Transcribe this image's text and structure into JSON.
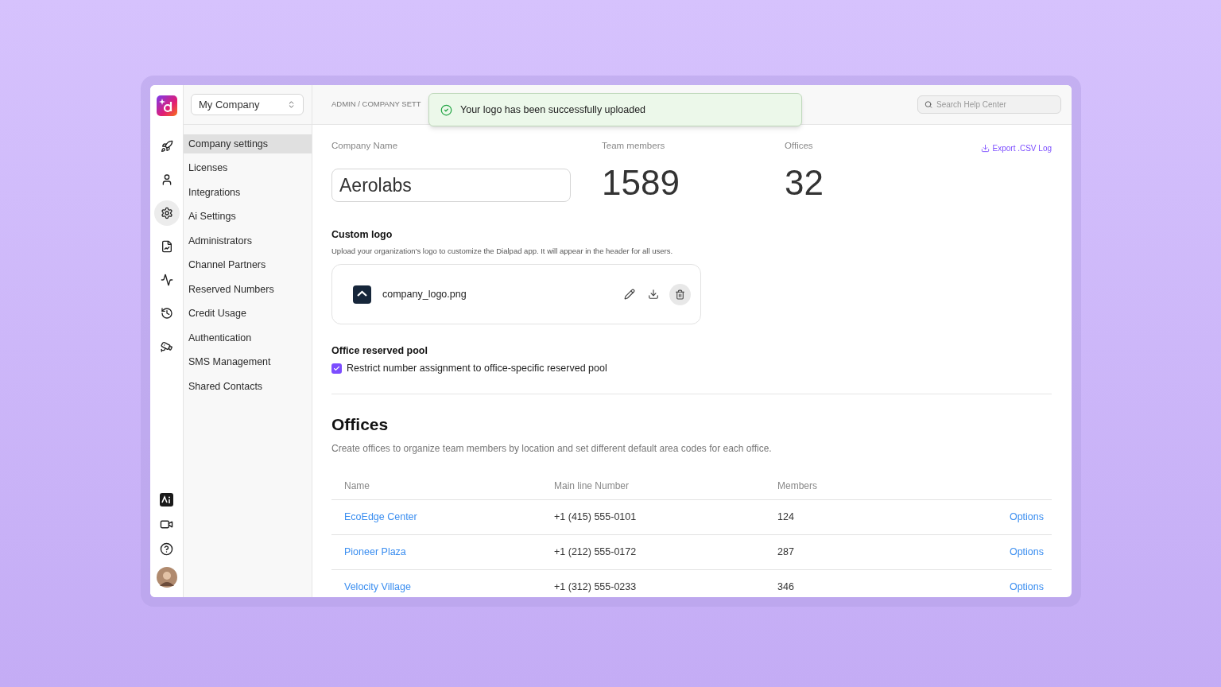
{
  "rail": {
    "top": [
      {
        "selected": false
      },
      {
        "selected": false
      },
      {
        "selected": true
      },
      {
        "selected": false
      },
      {
        "selected": false
      },
      {
        "selected": false
      },
      {
        "selected": false
      }
    ]
  },
  "company_switcher": {
    "value": "My Company"
  },
  "sidebar": {
    "items": [
      {
        "label": "Company settings",
        "selected": true
      },
      {
        "label": "Licenses",
        "selected": false
      },
      {
        "label": "Integrations",
        "selected": false
      },
      {
        "label": "Ai Settings",
        "selected": false
      },
      {
        "label": "Administrators",
        "selected": false
      },
      {
        "label": "Channel Partners",
        "selected": false
      },
      {
        "label": "Reserved Numbers",
        "selected": false
      },
      {
        "label": "Credit Usage",
        "selected": false
      },
      {
        "label": "Authentication",
        "selected": false
      },
      {
        "label": "SMS Management",
        "selected": false
      },
      {
        "label": "Shared Contacts",
        "selected": false
      }
    ]
  },
  "breadcrumb": "ADMIN / COMPANY SETT",
  "toast": {
    "message": "Your logo has been successfully uploaded"
  },
  "search": {
    "placeholder": "Search Help Center"
  },
  "stats": {
    "company_name_label": "Company Name",
    "company_name": "Aerolabs",
    "team_members_label": "Team members",
    "team_members": "1589",
    "offices_label": "Offices",
    "offices": "32",
    "export": "Export .CSV Log"
  },
  "custom_logo": {
    "title": "Custom logo",
    "description": "Upload your organization's logo to customize the Dialpad app. It will appear in the header for all users.",
    "file": "company_logo.png"
  },
  "reserved_pool": {
    "title": "Office reserved pool",
    "label": "Restrict number assignment to office-specific reserved pool",
    "checked": true
  },
  "offices": {
    "title": "Offices",
    "description": "Create offices to organize team members by location and set different default area codes for each office.",
    "columns": [
      "Name",
      "Main line Number",
      "Members"
    ],
    "rows": [
      {
        "name": "EcoEdge Center",
        "number": "+1 (415) 555-0101",
        "members": "124",
        "action": "Options"
      },
      {
        "name": "Pioneer Plaza",
        "number": "+1 (212) 555-0172",
        "members": "287",
        "action": "Options"
      },
      {
        "name": "Velocity Village",
        "number": "+1 (312) 555-0233",
        "members": "346",
        "action": "Options"
      }
    ]
  }
}
